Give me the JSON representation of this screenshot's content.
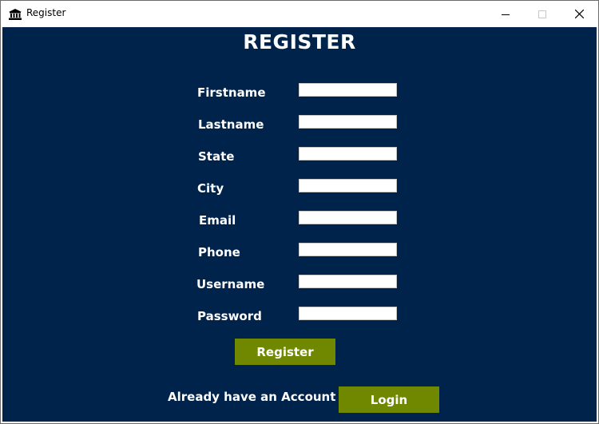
{
  "window": {
    "title": "Register",
    "icon": "bank-icon",
    "controls": [
      "minimize-icon",
      "maximize-icon",
      "close-icon"
    ]
  },
  "form": {
    "heading": "REGISTER",
    "fields": [
      {
        "label": "Firstname",
        "value": "",
        "placeholder": ""
      },
      {
        "label": "Lastname",
        "value": "",
        "placeholder": ""
      },
      {
        "label": "State",
        "value": "",
        "placeholder": ""
      },
      {
        "label": "City",
        "value": "",
        "placeholder": ""
      },
      {
        "label": "Email",
        "value": "",
        "placeholder": ""
      },
      {
        "label": "Phone",
        "value": "",
        "placeholder": ""
      },
      {
        "label": "Username",
        "value": "",
        "placeholder": ""
      },
      {
        "label": "Password",
        "value": "",
        "placeholder": ""
      }
    ],
    "register_label": "Register",
    "already_text": "Already have an Account",
    "login_label": "Login"
  },
  "colors": {
    "background": "#00234b",
    "button": "#6f8800",
    "text": "#ffffff"
  }
}
